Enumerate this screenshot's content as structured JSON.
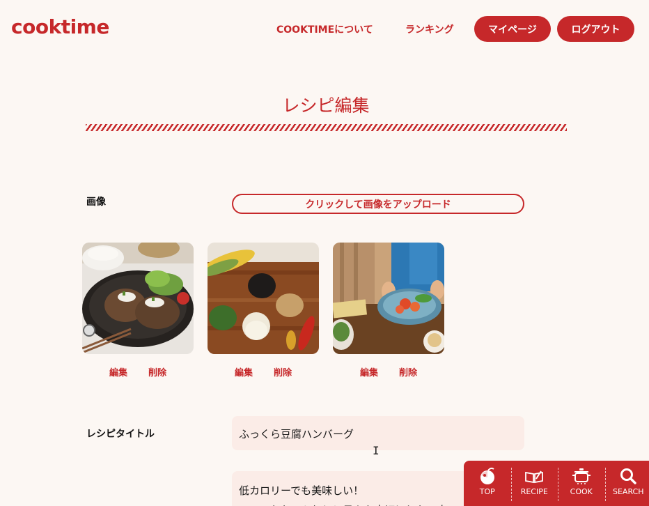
{
  "header": {
    "logo": "cooktime",
    "nav": {
      "about": "COOKTIMEについて",
      "ranking": "ランキング"
    },
    "buttons": {
      "mypage": "マイページ",
      "logout": "ログアウト"
    }
  },
  "page": {
    "title": "レシピ編集"
  },
  "form": {
    "image": {
      "label": "画像",
      "upload_button": "クリックして画像をアップロード",
      "thumbnails": [
        {
          "edit": "編集",
          "delete": "削除"
        },
        {
          "edit": "編集",
          "delete": "削除"
        },
        {
          "edit": "編集",
          "delete": "削除"
        }
      ]
    },
    "recipe_title": {
      "label": "レシピタイトル",
      "value": "ふっくら豆腐ハンバーグ"
    },
    "description": {
      "line1": "低カロリーでも美味しい！",
      "line2": "ソースもたっぷりと！日々を大切にしたい人へ一品。"
    }
  },
  "bottom_nav": {
    "items": [
      {
        "label": "TOP",
        "icon": "apple-icon"
      },
      {
        "label": "RECIPE",
        "icon": "book-icon"
      },
      {
        "label": "COOK",
        "icon": "pot-icon"
      },
      {
        "label": "SEARCH",
        "icon": "search-icon"
      }
    ]
  },
  "colors": {
    "brand": "#c6282a",
    "background": "#fcf7f3",
    "input_bg": "#fbece7"
  }
}
